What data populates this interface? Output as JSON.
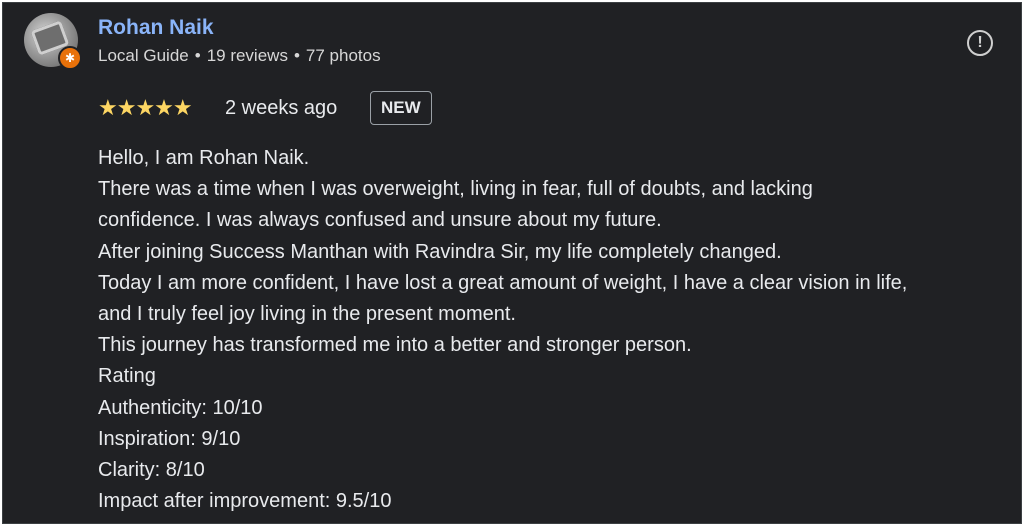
{
  "reviewer": {
    "name": "Rohan Naik",
    "role": "Local Guide",
    "reviews": "19 reviews",
    "photos": "77 photos",
    "separator": "•"
  },
  "rating": {
    "stars": "★★★★★",
    "value": 5,
    "max": 5,
    "star_color": "#fdd663"
  },
  "time_ago": "2 weeks ago",
  "badge": "NEW",
  "report_icon_glyph": "!",
  "review_lines": [
    "Hello, I am Rohan Naik.",
    "There was a time when I was overweight, living in fear, full of doubts, and lacking",
    "confidence. I was always confused and unsure about my future.",
    "After joining Success Manthan with Ravindra Sir, my life completely changed.",
    "Today I am more confident, I have lost a great amount of weight, I have a clear vision in life,",
    "and I truly feel joy living in the present moment.",
    "This journey has transformed me into a better and stronger person.",
    "Rating",
    "Authenticity: 10/10",
    "Inspiration: 9/10",
    "Clarity: 8/10",
    "Impact after improvement: 9.5/10"
  ],
  "colors": {
    "background": "#202124",
    "name": "#8ab4f8",
    "text": "#e8eaed",
    "guide_badge": "#e8710a"
  }
}
